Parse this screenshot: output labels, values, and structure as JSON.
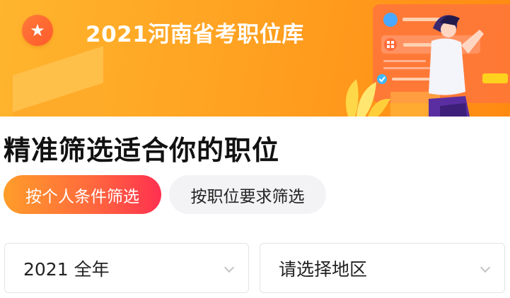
{
  "banner": {
    "title": "2021河南省考职位库",
    "badge_icon": "star-icon",
    "colors": {
      "start": "#ffb52e",
      "end": "#ff8a12"
    }
  },
  "section": {
    "title": "精准筛选适合你的职位"
  },
  "tabs": [
    {
      "label": "按个人条件筛选",
      "active": true
    },
    {
      "label": "按职位要求筛选",
      "active": false
    }
  ],
  "filters": {
    "year": {
      "value": "2021 全年"
    },
    "region": {
      "placeholder": "请选择地区"
    }
  },
  "accent": {
    "orange": "#ff9d2a",
    "red": "#ff3050"
  }
}
